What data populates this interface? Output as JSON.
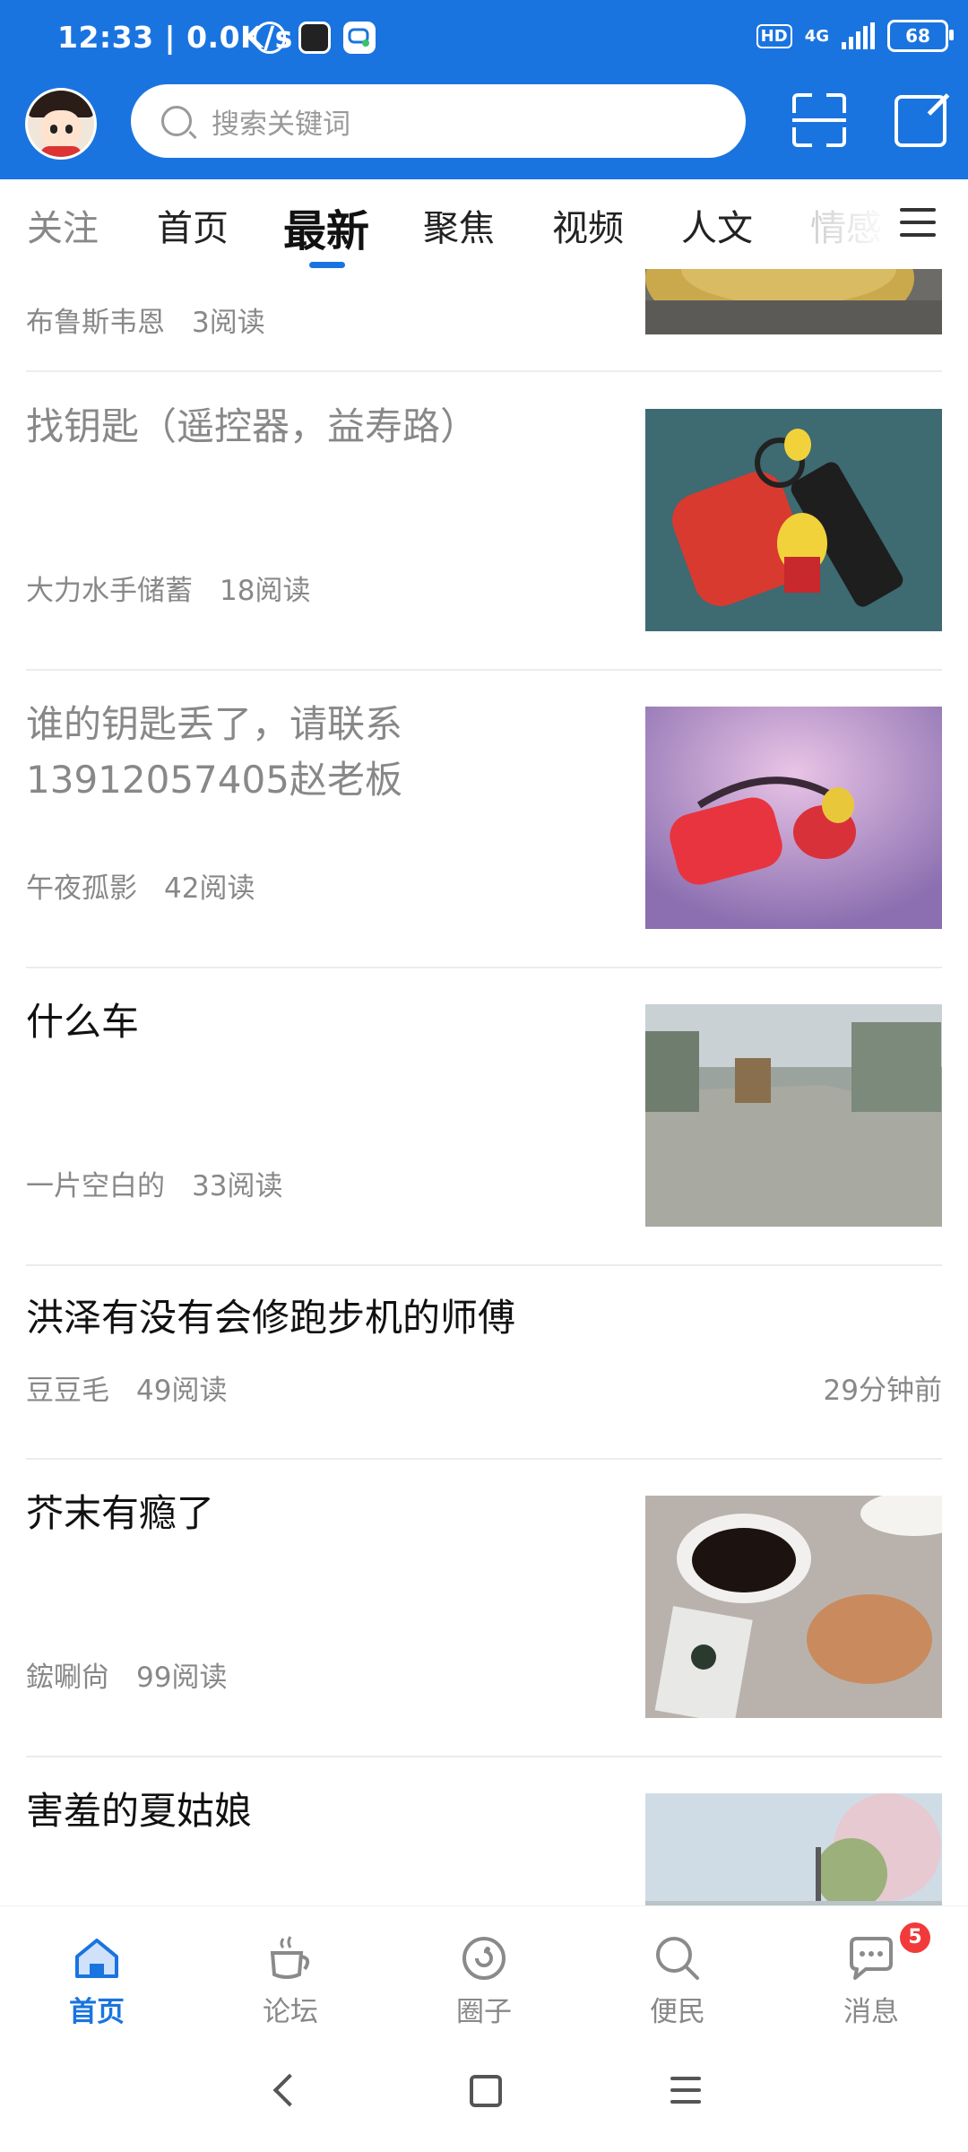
{
  "status_bar": {
    "time": "12:33",
    "net_speed": "0.0K/s",
    "hd_label": "HD",
    "network": "4G",
    "battery": "68",
    "icons": [
      "alarm-icon",
      "app-icon",
      "chat-icon"
    ]
  },
  "header": {
    "search_placeholder": "搜索关键词",
    "icons": [
      "avatar",
      "scan-icon",
      "edit-icon"
    ]
  },
  "tabs": {
    "items": [
      "关注",
      "首页",
      "最新",
      "聚焦",
      "视频",
      "人文",
      "情感"
    ],
    "partial_visible": "情感",
    "active": "最新"
  },
  "feed": {
    "items": [
      {
        "title": "",
        "author": "布鲁斯韦恩",
        "reads": "3阅读",
        "has_image": true,
        "read": true
      },
      {
        "title": "找钥匙（遥控器，益寿路）",
        "author": "大力水手储蓄",
        "reads": "18阅读",
        "has_image": true,
        "read": true
      },
      {
        "title": "谁的钥匙丢了，请联系13912057405赵老板",
        "author": "午夜孤影",
        "reads": "42阅读",
        "has_image": true,
        "read": true
      },
      {
        "title": "什么车",
        "author": "一片空白的",
        "reads": "33阅读",
        "has_image": true,
        "read": false
      },
      {
        "title": "洪泽有没有会修跑步机的师傅",
        "author": "豆豆毛",
        "reads": "49阅读",
        "time": "29分钟前",
        "has_image": false,
        "read": false
      },
      {
        "title": "芥末有瘾了",
        "author": "鋐唰尙",
        "reads": "99阅读",
        "has_image": true,
        "read": false
      },
      {
        "title": "害羞的夏姑娘",
        "author": "",
        "reads": "",
        "has_image": true,
        "read": false
      }
    ]
  },
  "bottom_nav": {
    "items": [
      {
        "label": "首页",
        "icon": "home-icon",
        "active": true
      },
      {
        "label": "论坛",
        "icon": "coffee-icon",
        "active": false
      },
      {
        "label": "圈子",
        "icon": "circle-icon",
        "active": false
      },
      {
        "label": "便民",
        "icon": "search-icon",
        "active": false
      },
      {
        "label": "消息",
        "icon": "message-icon",
        "active": false,
        "badge": "5"
      }
    ]
  },
  "colors": {
    "primary": "#1a74e0",
    "badge": "#f23a3a",
    "text_muted": "#888888"
  }
}
